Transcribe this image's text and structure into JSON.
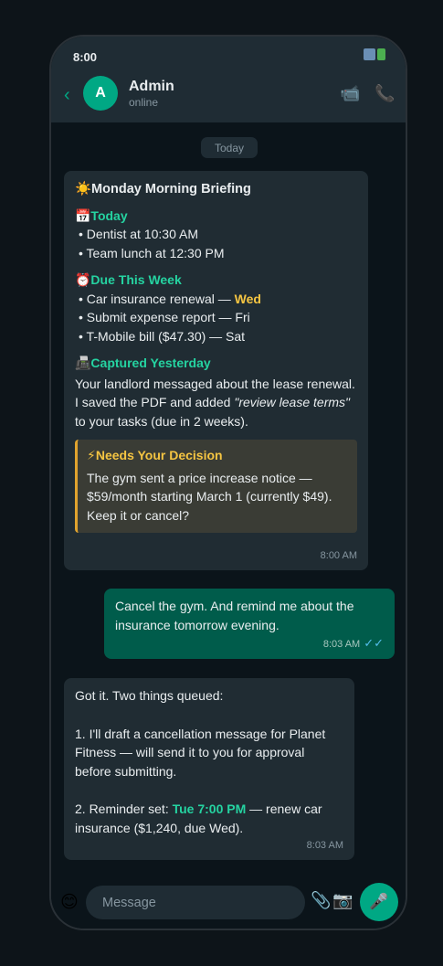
{
  "status_bar": {
    "time": "8:00"
  },
  "header": {
    "back_icon": "‹",
    "avatar_letter": "A",
    "name": "Admin",
    "status": "online",
    "video_icon": "📹",
    "call_icon": "📞"
  },
  "chat": {
    "date_chip": "Today",
    "briefing": {
      "title": "☀️Monday Morning Briefing",
      "today_head": "📅Today",
      "today_items": [
        "Dentist at 10:30 AM",
        "Team lunch at 12:30 PM"
      ],
      "due_head": "⏰Due This Week",
      "due_item1_text": "Car insurance renewal — ",
      "due_item1_day": "Wed",
      "due_item2": "Submit expense report — Fri",
      "due_item3": "T-Mobile bill ($47.30) — Sat",
      "captured_head": "📠Captured Yesterday",
      "captured_text_a": "Your landlord messaged about the lease renewal. I saved the PDF and added ",
      "captured_text_em": "\"review lease terms\"",
      "captured_text_b": " to your tasks (due in 2 weeks).",
      "decision_head": "⚡Needs Your Decision",
      "decision_text": "The gym sent a price increase notice — $59/month starting March 1 (currently $49). Keep it or cancel?",
      "time": "8:00 AM"
    },
    "reply": {
      "text": "Cancel the gym. And remind me about the insurance tomorrow evening.",
      "time": "8:03 AM",
      "ticks": "✓✓"
    },
    "response": {
      "line1": "Got it. Two things queued:",
      "item1": "1. I'll draft a cancellation message for Planet Fitness — will send it to you for approval before submitting.",
      "item2_a": "2. Reminder set: ",
      "item2_hl": "Tue 7:00 PM",
      "item2_b": " — renew car insurance ($1,240, due Wed).",
      "time": "8:03 AM"
    }
  },
  "composer": {
    "emoji_icon": "😊",
    "placeholder": "Message",
    "attach_icon": "📎",
    "camera_icon": "📷",
    "mic_icon": "🎤"
  }
}
